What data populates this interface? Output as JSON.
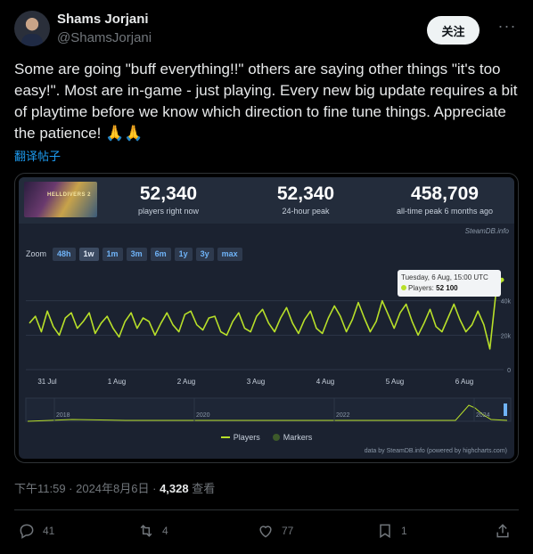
{
  "author": {
    "name": "Shams Jorjani",
    "handle": "@ShamsJorjani"
  },
  "follow_label": "关注",
  "more_label": "···",
  "tweet": {
    "text": "Some are going \"buff everything!!\" others are saying other things \"it's too easy!\". Most are in-game - just playing. Every new big update requires a bit of playtime before we know which direction to fine tune things. Appreciate the patience! 🙏🙏",
    "translate_label": "翻译帖子",
    "timestamp": "下午11:59 · 2024年8月6日 · ",
    "views": "4,328",
    "views_label": " 查看"
  },
  "steam_card": {
    "game_label": "HELLDIVERS 2",
    "stats": [
      {
        "value": "52,340",
        "label": "players right now"
      },
      {
        "value": "52,340",
        "label": "24-hour peak"
      },
      {
        "value": "458,709",
        "label": "all-time peak 6 months ago"
      }
    ],
    "source": "SteamDB.info",
    "zoom_label": "Zoom",
    "zoom_options": [
      "48h",
      "1w",
      "1m",
      "3m",
      "6m",
      "1y",
      "3y",
      "max"
    ],
    "zoom_active": "1w",
    "tooltip": {
      "date": "Tuesday, 6 Aug, 15:00 UTC",
      "series_label": "Players:",
      "value": "52 100"
    },
    "legend": [
      "Players",
      "Markers"
    ],
    "credit": "data by SteamDB.info (powered by highcharts.com)",
    "colors": {
      "line": "#b8e029",
      "marker": "#3d5a2a",
      "panel": "#1b2230"
    }
  },
  "chart_data": {
    "type": "line",
    "title": "",
    "xlabel": "",
    "ylabel": "",
    "x_ticks": [
      "31 Jul",
      "1 Aug",
      "2 Aug",
      "3 Aug",
      "4 Aug",
      "5 Aug",
      "6 Aug"
    ],
    "y_ticks": [
      "0",
      "20k",
      "40k"
    ],
    "ylim": [
      0,
      60000
    ],
    "series": [
      {
        "name": "Players",
        "values": [
          27000,
          31000,
          22000,
          34000,
          25000,
          20000,
          30000,
          33000,
          24000,
          28000,
          33000,
          21000,
          27000,
          31000,
          24000,
          19000,
          28000,
          33000,
          24000,
          30000,
          28000,
          20000,
          27000,
          33000,
          26000,
          22000,
          32000,
          34000,
          26000,
          23000,
          30000,
          31000,
          22000,
          20000,
          28000,
          33000,
          24000,
          22000,
          31000,
          35000,
          27000,
          22000,
          30000,
          36000,
          27000,
          21000,
          29000,
          34000,
          24000,
          21000,
          30000,
          37000,
          31000,
          22000,
          29000,
          39000,
          30000,
          22000,
          28000,
          40000,
          32000,
          24000,
          33000,
          38000,
          28000,
          20000,
          27000,
          35000,
          25000,
          22000,
          30000,
          38000,
          29000,
          22000,
          26000,
          34000,
          26000,
          12000,
          44000,
          52100
        ]
      }
    ],
    "navigator_ticks": [
      "2018",
      "2020",
      "2022",
      "2024"
    ],
    "legend": [
      "Players",
      "Markers"
    ]
  },
  "actions": {
    "replies": "41",
    "reposts": "4",
    "likes": "77",
    "bookmarks": "1"
  }
}
